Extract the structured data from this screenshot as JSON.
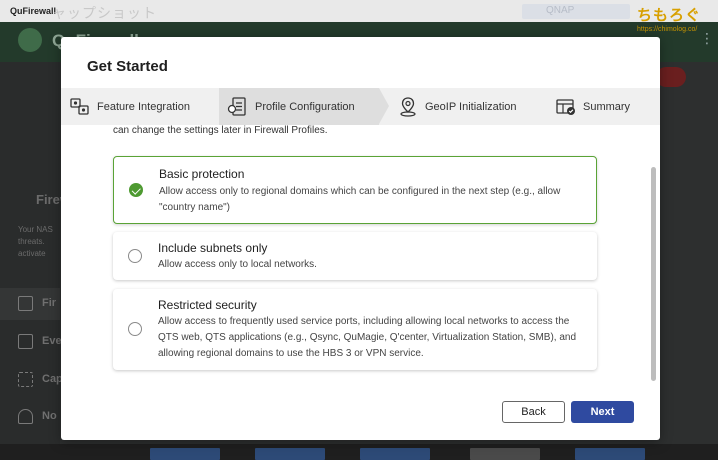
{
  "window": {
    "app_title": "QuFirewall",
    "ghost_title": "ャップショット",
    "ghost_right_text": "QNAP"
  },
  "background_app": {
    "app_name": "QuFirewall",
    "left_heading": "Firewall",
    "left_text_lines": [
      "Your NAS",
      "threats.",
      "activate"
    ],
    "nav_items": [
      {
        "label": "Fir",
        "icon": "firewall-icon"
      },
      {
        "label": "Eve",
        "icon": "event-log-icon"
      },
      {
        "label": "Cap",
        "icon": "capture-icon"
      },
      {
        "label": "No",
        "icon": "notification-icon"
      }
    ]
  },
  "watermark": {
    "logo_text": "ちもろぐ",
    "url": "https://chimolog.co/"
  },
  "modal": {
    "title": "Get Started",
    "steps": [
      {
        "label": "Feature Integration",
        "icon": "feature-integration-icon"
      },
      {
        "label": "Profile Configuration",
        "icon": "profile-configuration-icon",
        "active": true
      },
      {
        "label": "GeoIP Initialization",
        "icon": "geoip-icon"
      },
      {
        "label": "Summary",
        "icon": "summary-icon"
      }
    ],
    "intro_text": "can change the settings later in Firewall Profiles.",
    "options": [
      {
        "title": "Basic protection",
        "description": "Allow access only to regional domains which can be configured in the next step (e.g., allow \"country name\")",
        "selected": true
      },
      {
        "title": "Include subnets only",
        "description": "Allow access only to local networks.",
        "selected": false
      },
      {
        "title": "Restricted security",
        "description": "Allow access to frequently used service ports, including allowing local networks to access the QTS web, QTS applications (e.g., Qsync, QuMagie, Q'center, Virtualization Station, SMB), and allowing regional domains to use the HBS 3 or VPN service.",
        "selected": false
      }
    ],
    "buttons": {
      "back": "Back",
      "next": "Next"
    }
  },
  "colors": {
    "selected_border": "#5aa336",
    "check_fill": "#4e9a31",
    "next_button": "#2f4aa0",
    "stepper_bg": "#f0f0f0",
    "stepper_active_bg": "#dedede"
  }
}
